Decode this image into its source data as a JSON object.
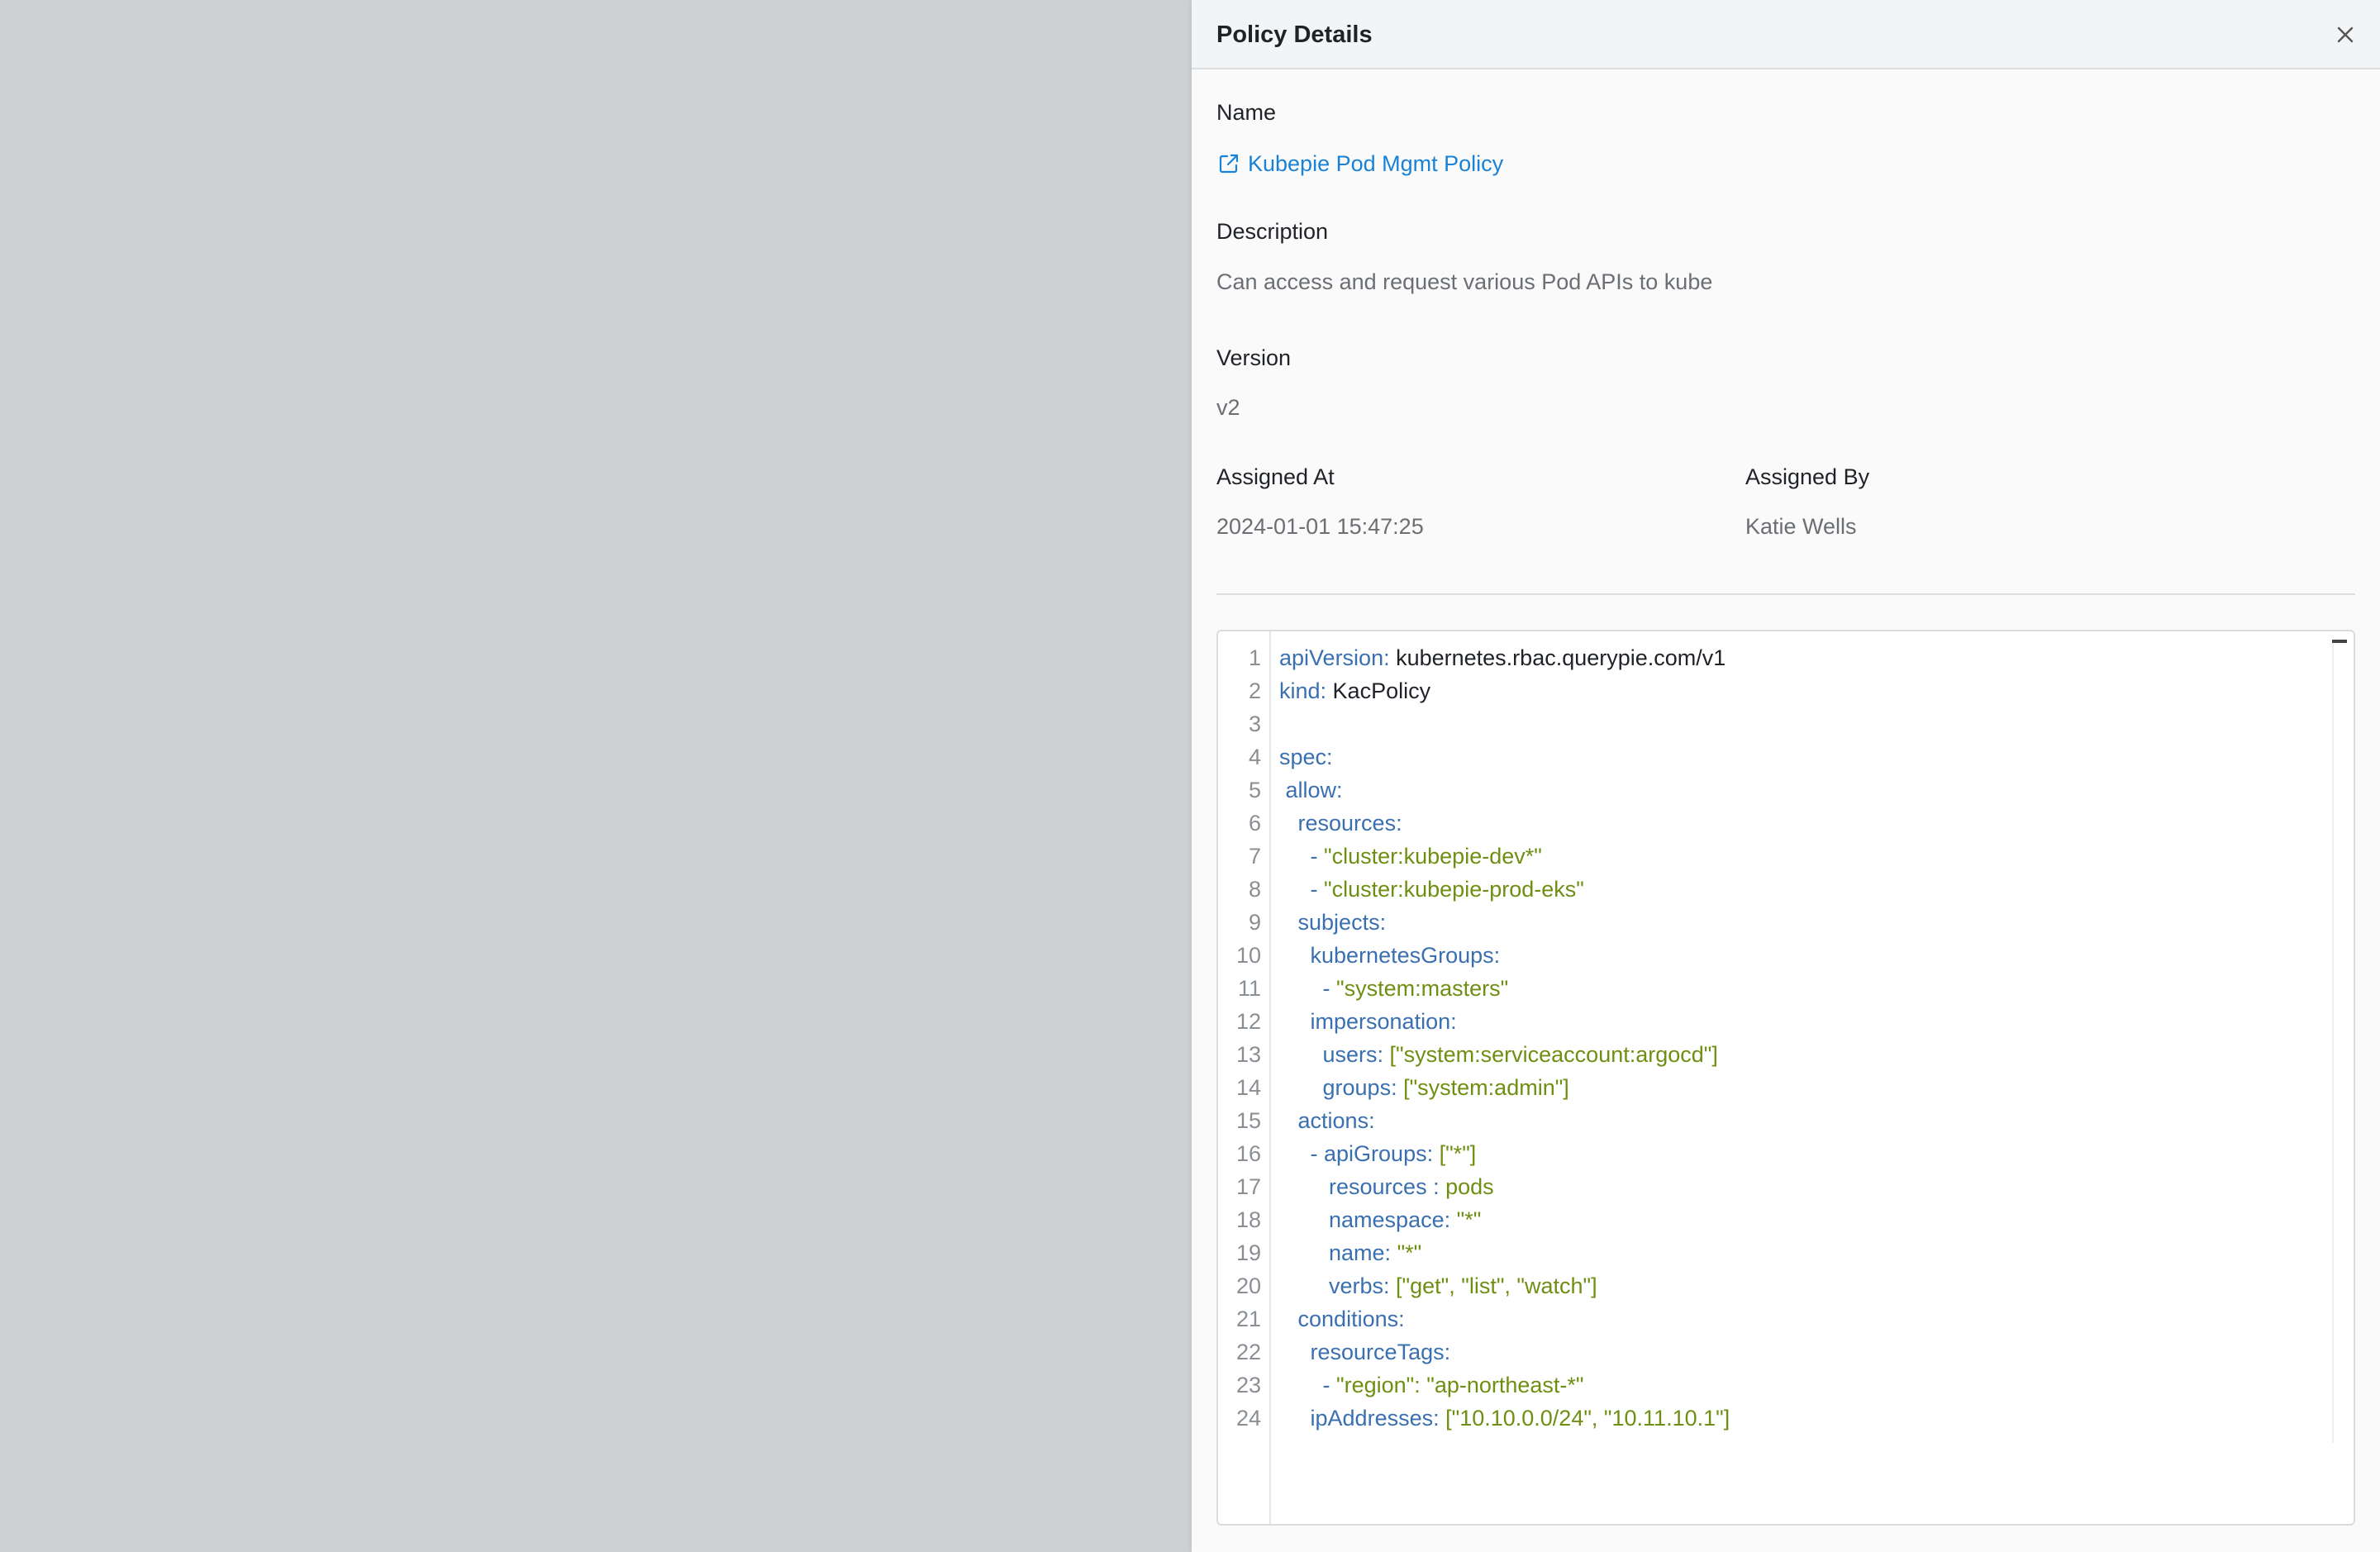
{
  "drawer": {
    "title": "Policy Details"
  },
  "fields": {
    "name_label": "Name",
    "name_value": "Kubepie Pod Mgmt Policy",
    "description_label": "Description",
    "description_value": "Can access and request various Pod APIs to kube",
    "version_label": "Version",
    "version_value": "v2",
    "assigned_at_label": "Assigned At",
    "assigned_at_value": "2024-01-01 15:47:25",
    "assigned_by_label": "Assigned By",
    "assigned_by_value": "Katie Wells"
  },
  "editor": {
    "lines": [
      {
        "n": "1",
        "key": "apiVersion:",
        "val": " kubernetes.rbac.querypie.com/v1",
        "valType": "p",
        "indent": ""
      },
      {
        "n": "2",
        "key": "kind:",
        "val": " KacPolicy",
        "valType": "p",
        "indent": ""
      },
      {
        "n": "3",
        "key": "",
        "val": "",
        "valType": "p",
        "indent": ""
      },
      {
        "n": "4",
        "key": "spec:",
        "val": "",
        "valType": "p",
        "indent": ""
      },
      {
        "n": "5",
        "key": "allow:",
        "val": "",
        "valType": "p",
        "indent": " "
      },
      {
        "n": "6",
        "key": "resources:",
        "val": "",
        "valType": "p",
        "indent": "   "
      },
      {
        "n": "7",
        "key": "- ",
        "val": "\"cluster:kubepie-dev*\"",
        "valType": "s",
        "indent": "     "
      },
      {
        "n": "8",
        "key": "- ",
        "val": "\"cluster:kubepie-prod-eks\"",
        "valType": "s",
        "indent": "     "
      },
      {
        "n": "9",
        "key": "subjects:",
        "val": "",
        "valType": "p",
        "indent": "   "
      },
      {
        "n": "10",
        "key": "kubernetesGroups:",
        "val": "",
        "valType": "p",
        "indent": "     "
      },
      {
        "n": "11",
        "key": "- ",
        "val": "\"system:masters\"",
        "valType": "s",
        "indent": "       "
      },
      {
        "n": "12",
        "key": "impersonation:",
        "val": "",
        "valType": "p",
        "indent": "     "
      },
      {
        "n": "13",
        "key": "users:",
        "val": " [\"system:serviceaccount:argocd\"]",
        "valType": "s",
        "indent": "       "
      },
      {
        "n": "14",
        "key": "groups:",
        "val": " [\"system:admin\"]",
        "valType": "s",
        "indent": "       "
      },
      {
        "n": "15",
        "key": "actions:",
        "val": "",
        "valType": "p",
        "indent": "   "
      },
      {
        "n": "16",
        "key": "- apiGroups:",
        "val": " [\"*\"]",
        "valType": "s",
        "indent": "     "
      },
      {
        "n": "17",
        "key": "resources :",
        "val": " pods",
        "valType": "s",
        "indent": "        "
      },
      {
        "n": "18",
        "key": "namespace:",
        "val": " \"*\"",
        "valType": "s",
        "indent": "        "
      },
      {
        "n": "19",
        "key": "name:",
        "val": " \"*\"",
        "valType": "s",
        "indent": "        "
      },
      {
        "n": "20",
        "key": "verbs:",
        "val": " [\"get\", \"list\", \"watch\"]",
        "valType": "s",
        "indent": "        "
      },
      {
        "n": "21",
        "key": "conditions:",
        "val": "",
        "valType": "p",
        "indent": "   "
      },
      {
        "n": "22",
        "key": "resourceTags:",
        "val": "",
        "valType": "p",
        "indent": "     "
      },
      {
        "n": "23",
        "key": "- ",
        "val": "\"region\": \"ap-northeast-*\"",
        "valType": "s",
        "indent": "       "
      },
      {
        "n": "24",
        "key": "ipAddresses:",
        "val": " [\"10.10.0.0/24\", \"10.11.10.1\"]",
        "valType": "s",
        "indent": "     "
      }
    ]
  }
}
